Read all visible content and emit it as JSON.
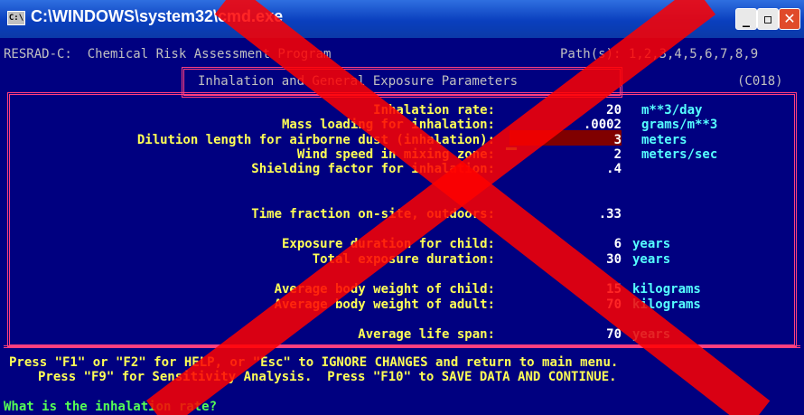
{
  "window": {
    "title": "C:\\WINDOWS\\system32\\cmd.exe",
    "icon_label": "C:\\",
    "controls": [
      "minimize-icon",
      "maximize-icon",
      "close-icon"
    ]
  },
  "header": {
    "program": "RESRAD-C:  Chemical Risk Assessment Program",
    "paths": "Path(s): 1,2,3,4,5,6,7,8,9",
    "screen_title": "Inhalation and General Exposure Parameters",
    "screen_code": "(C018)"
  },
  "params": [
    {
      "label": "Inhalation rate:",
      "value": "20",
      "unit": "m**3/day"
    },
    {
      "label": "Mass loading for inhalation:",
      "value": ".0002",
      "unit": "grams/m**3"
    },
    {
      "label": "Dilution length for airborne dust (inhalation):",
      "value": "3",
      "unit": "meters"
    },
    {
      "label": "Wind speed in mixing zone:",
      "value": "2",
      "unit": "meters/sec"
    },
    {
      "label": "Shielding factor for inhalation:",
      "value": ".4",
      "unit": ""
    },
    {
      "label": "Time fraction on-site, outdoors:",
      "value": ".33",
      "unit": ""
    },
    {
      "label": "Exposure duration for child:",
      "value": "6",
      "unit": "years"
    },
    {
      "label": "Total exposure duration:",
      "value": "30",
      "unit": "years"
    },
    {
      "label": "Average body weight of child:",
      "value": "15",
      "unit": "kilograms"
    },
    {
      "label": "Average body weight of adult:",
      "value": "70",
      "unit": "kilograms"
    },
    {
      "label": "Average life span:",
      "value": "70",
      "unit": "years"
    }
  ],
  "footer": {
    "line1": "Press \"F1\" or \"F2\" for HELP, or \"Esc\" to IGNORE CHANGES and return to main menu.",
    "line2": "Press \"F9\" for Sensitivity Analysis.  Press \"F10\" to SAVE DATA AND CONTINUE."
  },
  "prompt": "What is the inhalation rate?",
  "colors": {
    "background": "#000080",
    "label": "#ffff55",
    "unit": "#55ffff",
    "frame": "#ff3f7f",
    "highlight": "#800000",
    "cross": "#ff0000"
  }
}
